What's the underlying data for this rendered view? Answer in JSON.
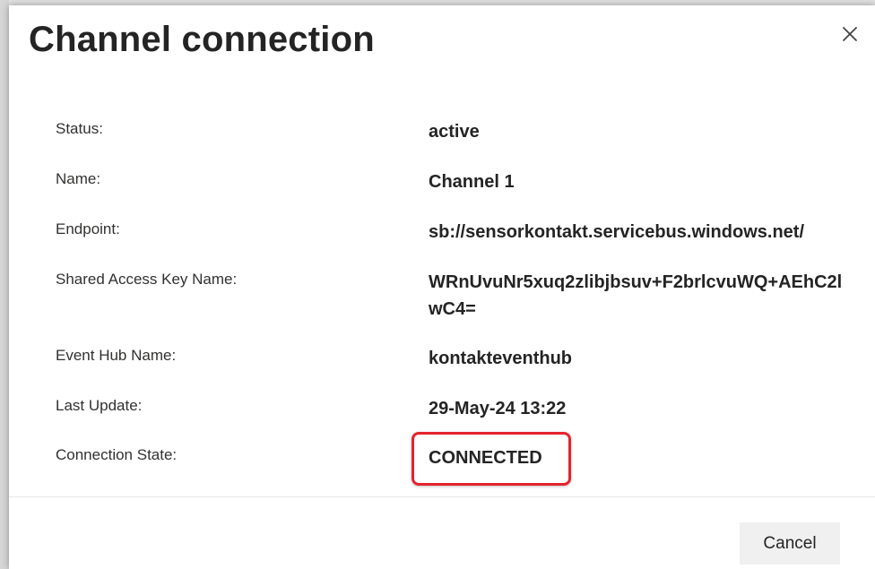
{
  "dialog": {
    "title": "Channel connection",
    "close_icon": "close-icon",
    "details": [
      {
        "label": "Status:",
        "value": "active"
      },
      {
        "label": "Name:",
        "value": "Channel 1"
      },
      {
        "label": "Endpoint:",
        "value": "sb://sensorkontakt.servicebus.windows.net/"
      },
      {
        "label": "Shared Access Key Name:",
        "value": "WRnUvuNr5xuq2zlibjbsuv+F2brlcvuWQ+AEhC2lwC4="
      },
      {
        "label": "Event Hub Name:",
        "value": "kontakteventhub"
      },
      {
        "label": "Last Update:",
        "value": "29-May-24 13:22"
      },
      {
        "label": "Connection State:",
        "value": "CONNECTED"
      }
    ],
    "highlight_color": "#e3242b",
    "cancel_label": "Cancel"
  }
}
